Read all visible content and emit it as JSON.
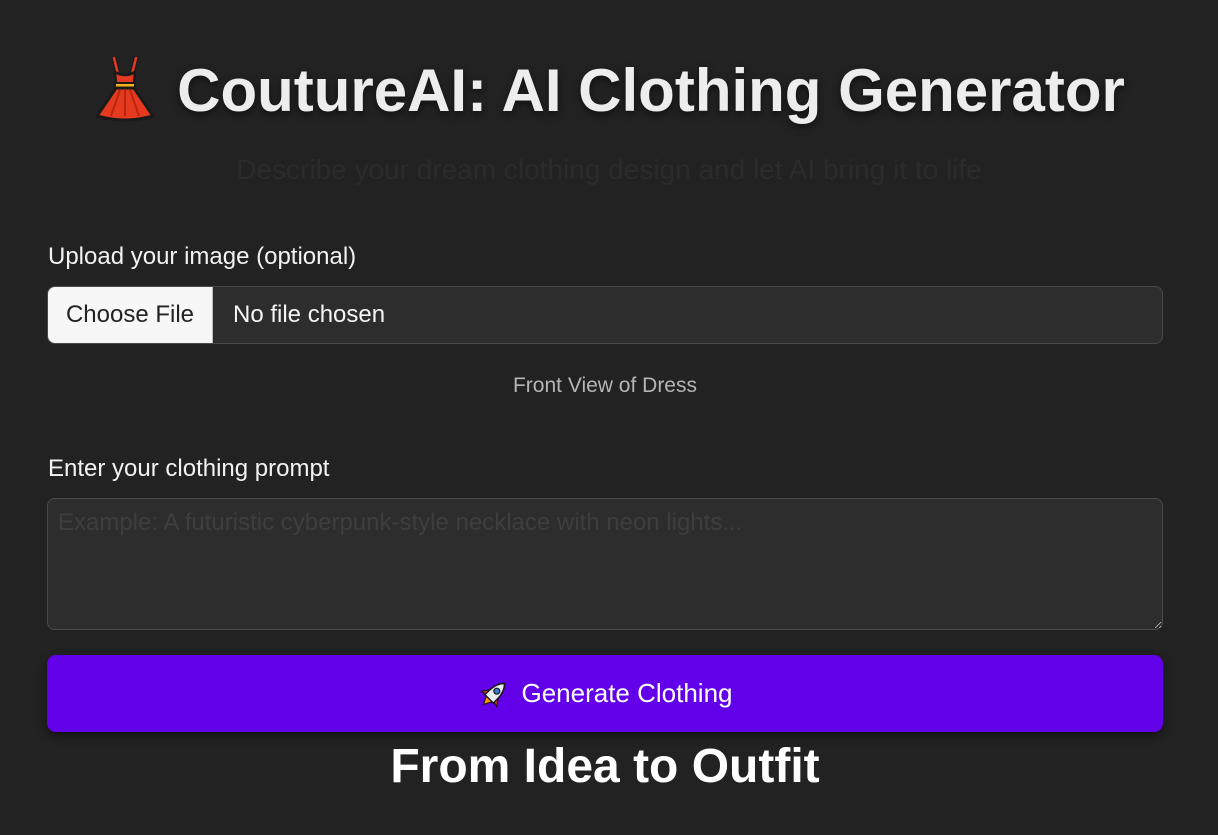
{
  "header": {
    "icon": "red-dress-icon",
    "title": "CoutureAI: AI Clothing Generator",
    "subtitle": "Describe your dream clothing design and let AI bring it to life"
  },
  "upload": {
    "label": "Upload your image (optional)",
    "button_label": "Choose File",
    "status": "No file chosen",
    "caption": "Front View of Dress"
  },
  "prompt": {
    "label": "Enter your clothing prompt",
    "placeholder": "Example: A futuristic cyberpunk-style necklace with neon lights...",
    "value": ""
  },
  "generate": {
    "icon": "rocket-icon",
    "label": "Generate Clothing"
  },
  "tagline": "From Idea to Outfit",
  "colors": {
    "background": "#222222",
    "accent": "#6200ea",
    "input_background": "#2d2d2d"
  }
}
